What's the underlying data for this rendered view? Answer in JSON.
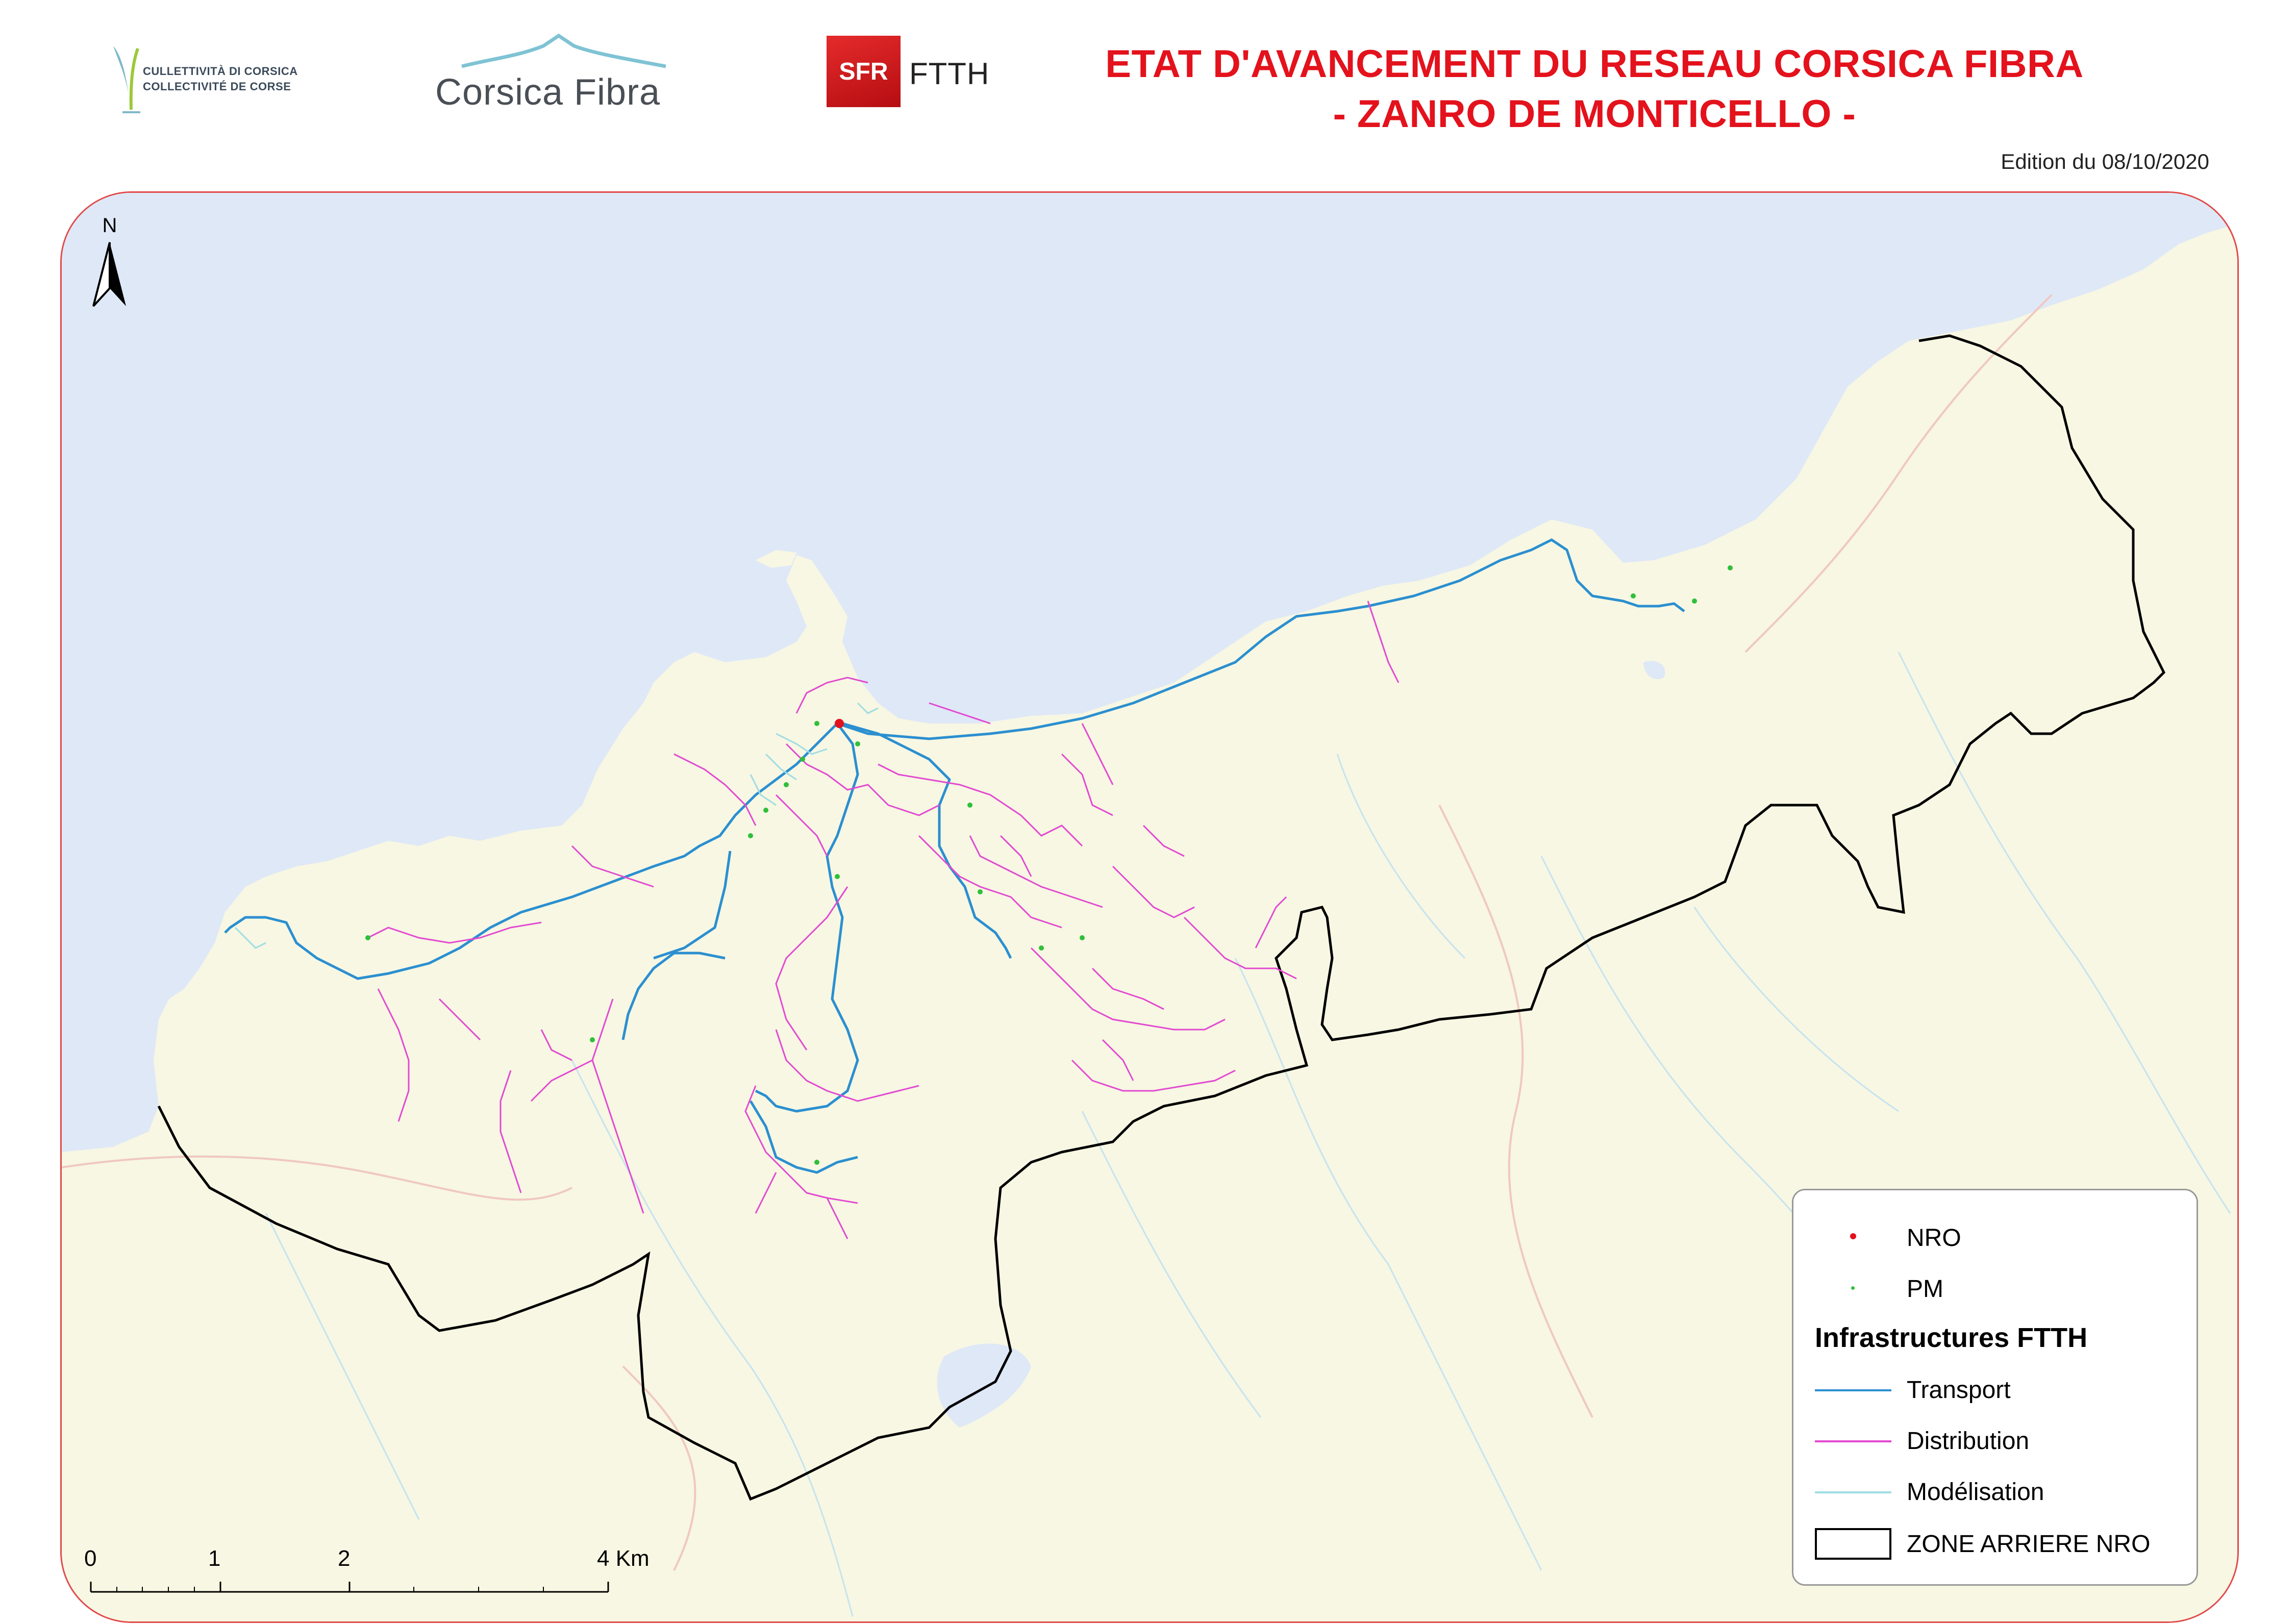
{
  "header": {
    "logo_collectivite_line1": "CULLETTIVITÀ DI CORSICA",
    "logo_collectivite_line2": "COLLECTIVITÉ DE CORSE",
    "logo_corsica_fibra": "Corsica Fibra",
    "logo_sfr": "SFR",
    "logo_ftth": "FTTH",
    "title_line1": "ETAT D'AVANCEMENT DU RESEAU CORSICA FIBRA",
    "title_line2": "- ZANRO DE MONTICELLO -",
    "edition": "Edition du 08/10/2020"
  },
  "map": {
    "north_label": "N",
    "scale": {
      "ticks": [
        "0",
        "1",
        "2",
        "4 Km"
      ],
      "values_km": [
        0,
        1,
        2,
        4
      ]
    },
    "colors": {
      "sea": "#dfe8f7",
      "land": "#f7f7e3",
      "zone_outline": "#000000",
      "transport": "#2b8fd0",
      "distribution": "#e34ad1",
      "modelisation": "#9fdde3",
      "nro": "#e3121c",
      "pm": "#2fbf3a",
      "roads": "#f0c8c0",
      "streams": "#c7e3ef"
    }
  },
  "legend": {
    "nro_label": "NRO",
    "pm_label": "PM",
    "heading": "Infrastructures FTTH",
    "transport_label": "Transport",
    "distribution_label": "Distribution",
    "modelisation_label": "Modélisation",
    "zone_label": "ZONE ARRIERE NRO"
  }
}
